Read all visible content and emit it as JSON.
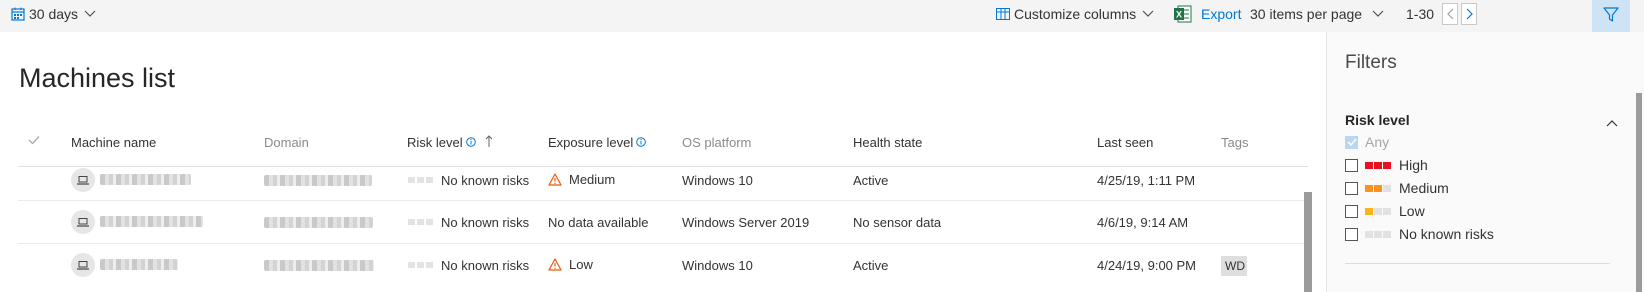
{
  "toolbar": {
    "date_range_label": "30 days",
    "customize_columns_label": "Customize columns",
    "export_label": "Export",
    "items_per_page_label": "30 items per page",
    "pager_range": "1-30"
  },
  "page_title": "Machines list",
  "table": {
    "columns": {
      "machine_name": "Machine name",
      "domain": "Domain",
      "risk_level": "Risk level",
      "exposure_level": "Exposure level",
      "os_platform": "OS platform",
      "health_state": "Health state",
      "last_seen": "Last seen",
      "tags": "Tags"
    },
    "rows": [
      {
        "risk": "No known risks",
        "exposure": "Medium",
        "exposure_icon": "warning-icon",
        "os": "Windows 10",
        "health": "Active",
        "last_seen": "4/25/19, 1:11 PM",
        "tag": ""
      },
      {
        "risk": "No known risks",
        "exposure": "No data available",
        "exposure_icon": "",
        "os": "Windows Server 2019",
        "health": "No sensor data",
        "last_seen": "4/6/19, 9:14 AM",
        "tag": ""
      },
      {
        "risk": "No known risks",
        "exposure": "Low",
        "exposure_icon": "warning-icon",
        "os": "Windows 10",
        "health": "Active",
        "last_seen": "4/24/19, 9:00 PM",
        "tag": "WD"
      }
    ]
  },
  "filters": {
    "title": "Filters",
    "risk_section_title": "Risk level",
    "options": [
      {
        "label": "Any",
        "checked": true
      },
      {
        "label": "High",
        "checked": false
      },
      {
        "label": "Medium",
        "checked": false
      },
      {
        "label": "Low",
        "checked": false
      },
      {
        "label": "No known risks",
        "checked": false
      }
    ]
  },
  "colors": {
    "accent": "#0078d4",
    "high": "#e81123",
    "medium": "#f7931e",
    "low": "#fcb316",
    "warning": "#e8590c",
    "excel_green": "#217346",
    "filter_active_bg": "#cfe3f6"
  }
}
